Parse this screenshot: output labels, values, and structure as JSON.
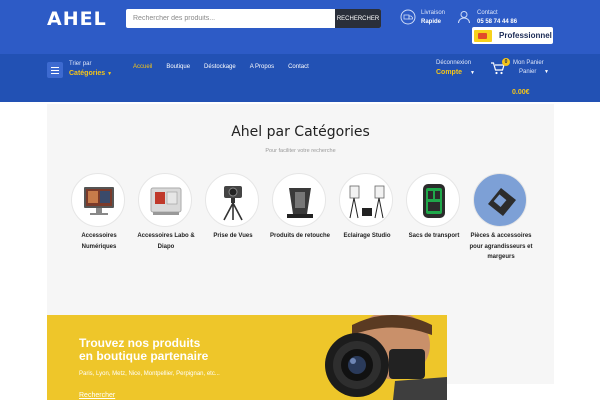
{
  "header": {
    "logo": "AHEL",
    "search": {
      "placeholder": "Rechercher des produits...",
      "button_label": "RECHERCHER"
    },
    "delivery": {
      "line1": "Livraison",
      "line2": "Rapide",
      "icon": "truck-icon"
    },
    "contact": {
      "line1": "Contact",
      "line2": "05 58 74 44 86",
      "icon": "user-icon"
    },
    "pro_button": "Professionnel"
  },
  "nav": {
    "categories_line1": "Trier par",
    "categories_line2": "Catégories",
    "links": [
      "Accueil",
      "Boutique",
      "Déstockage",
      "A Propos",
      "Contact"
    ],
    "active_link": "Accueil",
    "account_line1": "Déconnexion",
    "account_line2": "Compte",
    "cart_line1": "Mon Panier",
    "cart_line2": "Panier",
    "cart_count": "0",
    "cart_total": "0.00€"
  },
  "categories": {
    "title": "Ahel par Catégories",
    "subtitle": "Pour faciliter votre recherche",
    "items": [
      {
        "label": "Accessoires Numériques",
        "icon": "monitor-icon"
      },
      {
        "label": "Accessoires Labo & Diapo",
        "icon": "lab-box-icon"
      },
      {
        "label": "Prise de Vues",
        "icon": "camera-tripod-icon"
      },
      {
        "label": "Produits de retouche",
        "icon": "loupe-icon"
      },
      {
        "label": "Eclairage Studio",
        "icon": "studio-light-icon"
      },
      {
        "label": "Sacs de transport",
        "icon": "backpack-icon"
      },
      {
        "label": "Pièces & accessoires pour agrandisseurs et margeurs",
        "icon": "easel-icon"
      }
    ]
  },
  "banner": {
    "title_line1": "Trouvez nos produits",
    "title_line2": "en boutique partenaire",
    "cities": "Paris, Lyon, Metz, Nice, Montpellier, Perpignan, etc...",
    "cta": "Rechercher"
  },
  "colors": {
    "header": "#2d5bc6",
    "nav": "#2251b4",
    "accent": "#f5c518",
    "banner": "#eec62a"
  }
}
